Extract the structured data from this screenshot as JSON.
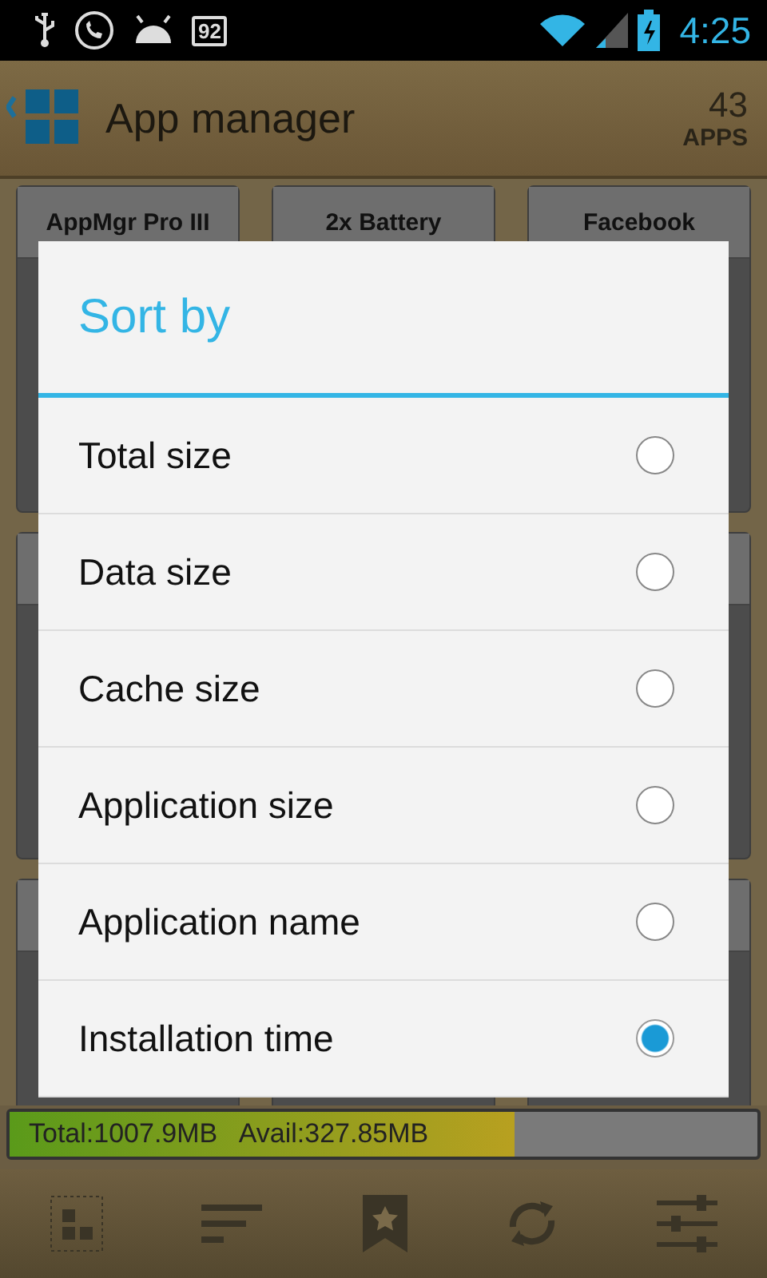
{
  "status_bar": {
    "notification_badge": "92",
    "time": "4:25"
  },
  "header": {
    "title": "App manager",
    "count": "43",
    "count_label": "APPS"
  },
  "cards": [
    {
      "label": "AppMgr Pro III"
    },
    {
      "label": "2x Battery"
    },
    {
      "label": "Facebook"
    }
  ],
  "storage": {
    "text": "Total:1007.9MB   Avail:327.85MB",
    "level": 0.675
  },
  "dialog": {
    "title": "Sort by",
    "options": [
      {
        "label": "Total size",
        "selected": false
      },
      {
        "label": "Data size",
        "selected": false
      },
      {
        "label": "Cache size",
        "selected": false
      },
      {
        "label": "Application size",
        "selected": false
      },
      {
        "label": "Application name",
        "selected": false
      },
      {
        "label": "Installation time",
        "selected": true
      }
    ]
  }
}
